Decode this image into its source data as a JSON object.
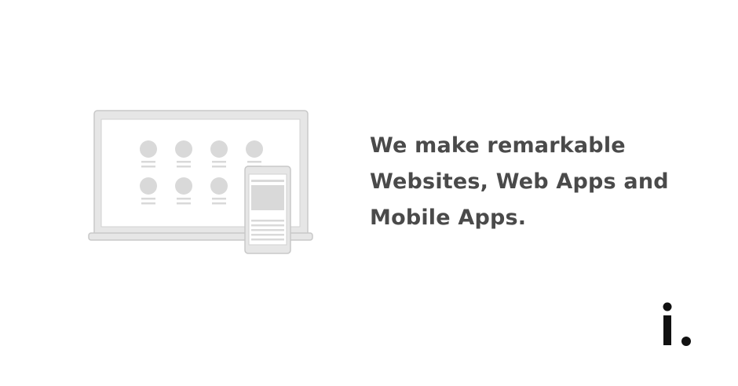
{
  "headline": {
    "lines": [
      "We make remarkable",
      "Websites, Web Apps and",
      "Mobile Apps."
    ]
  },
  "illustration": {
    "name": "laptop-and-phone-illustration",
    "colors": {
      "device_stroke": "#c8c8c8",
      "device_fill": "#e6e6e6",
      "screen_fill": "#ffffff",
      "placeholder": "#d9d9d9"
    }
  },
  "logo": {
    "icon": "i-dot-logo",
    "color": "#111111"
  },
  "colors": {
    "background": "#ffffff",
    "text": "#4a4a4a"
  }
}
